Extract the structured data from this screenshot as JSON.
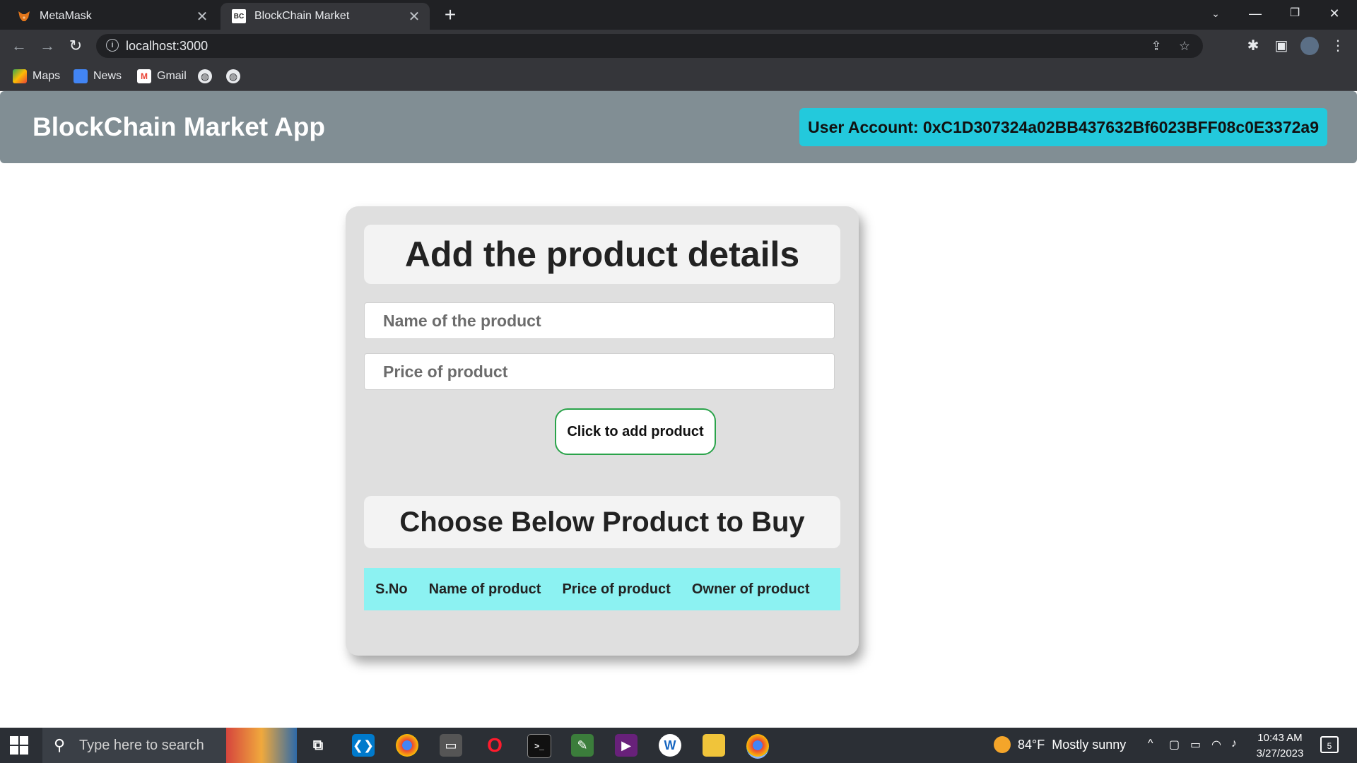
{
  "browser": {
    "tabs": [
      {
        "title": "MetaMask",
        "favicon": "fox-icon",
        "active": false
      },
      {
        "title": "BlockChain Market",
        "favicon": "bc-icon",
        "favicon_text": "BC",
        "active": true
      }
    ],
    "url": "localhost:3000",
    "bookmarks": [
      {
        "label": "Maps",
        "icon": "maps-icon"
      },
      {
        "label": "News",
        "icon": "news-icon"
      },
      {
        "label": "Gmail",
        "icon": "gmail-icon"
      }
    ]
  },
  "app": {
    "title": "BlockChain Market App",
    "account_label": "User Account: 0xC1D307324a02BB437632Bf6023BFF08c0E3372a9"
  },
  "form": {
    "heading": "Add the product details",
    "name_placeholder": "Name of the product",
    "name_value": "",
    "price_placeholder": "Price of product",
    "price_value": "",
    "submit_label": "Click to add product"
  },
  "products": {
    "heading": "Choose Below Product to Buy",
    "columns": [
      "S.No",
      "Name of product",
      "Price of product",
      "Owner of product"
    ],
    "rows": []
  },
  "taskbar": {
    "search_placeholder": "Type here to search",
    "weather_temp": "84°F",
    "weather_text": "Mostly sunny",
    "time": "10:43 AM",
    "date": "3/27/2023",
    "notification_count": "5"
  },
  "colors": {
    "header_bg": "#818e94",
    "account_bg": "#23c9dc",
    "card_bg": "#dfdfdf",
    "table_header_bg": "#8cf2f2",
    "button_border": "#2aa34a"
  }
}
